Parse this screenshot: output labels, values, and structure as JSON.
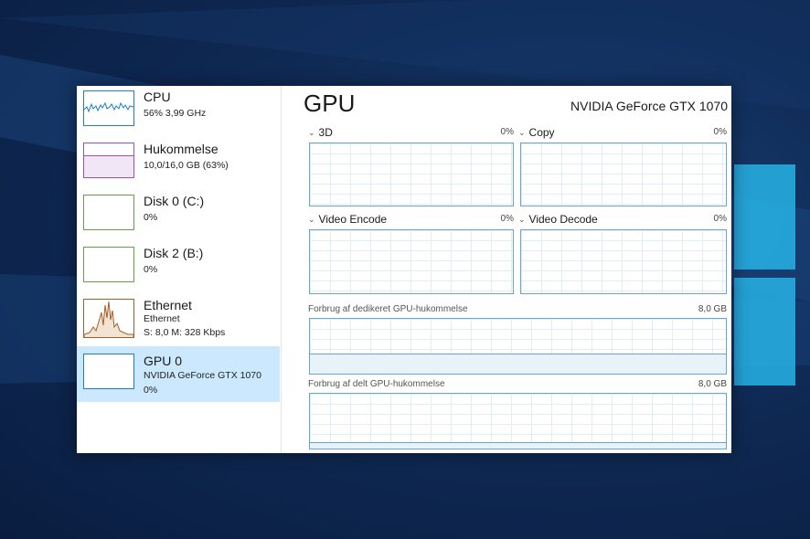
{
  "sidebar": {
    "items": [
      {
        "title": "CPU",
        "sub1": "56%  3,99 GHz",
        "sub2": "",
        "sub3": "",
        "color": "#1c7fc2"
      },
      {
        "title": "Hukommelse",
        "sub1": "10,0/16,0 GB (63%)",
        "sub2": "",
        "sub3": "",
        "color": "#9b4fc0",
        "fill_fraction": 0.63
      },
      {
        "title": "Disk 0 (C:)",
        "sub1": "0%",
        "sub2": "",
        "sub3": "",
        "color": "#5fa34a"
      },
      {
        "title": "Disk 2 (B:)",
        "sub1": "0%",
        "sub2": "",
        "sub3": "",
        "color": "#5fa34a"
      },
      {
        "title": "Ethernet",
        "sub1": "Ethernet",
        "sub2": "S: 8,0  M: 328 Kbps",
        "sub3": "",
        "color": "#a0602a"
      },
      {
        "title": "GPU 0",
        "sub1": "NVIDIA GeForce GTX 1070",
        "sub2": "0%",
        "sub3": "",
        "color": "#1c7fc2",
        "selected": true
      }
    ]
  },
  "main": {
    "title": "GPU",
    "model": "NVIDIA GeForce GTX 1070",
    "graphs": [
      {
        "label": "3D",
        "percent": "0%"
      },
      {
        "label": "Copy",
        "percent": "0%"
      },
      {
        "label": "Video Encode",
        "percent": "0%"
      },
      {
        "label": "Video Decode",
        "percent": "0%"
      }
    ],
    "memory": [
      {
        "label": "Forbrug af dedikeret GPU-hukommelse",
        "value": "8,0 GB",
        "fill_fraction": 0.35
      },
      {
        "label": "Forbrug af delt GPU-hukommelse",
        "value": "8,0 GB",
        "fill_fraction": 0.1
      }
    ]
  },
  "colors": {
    "graph_border": "#6aa6c8",
    "selected_bg": "#cce8ff",
    "desktop_bg": "#0f2a55",
    "windows_tile": "#27b3e6"
  }
}
